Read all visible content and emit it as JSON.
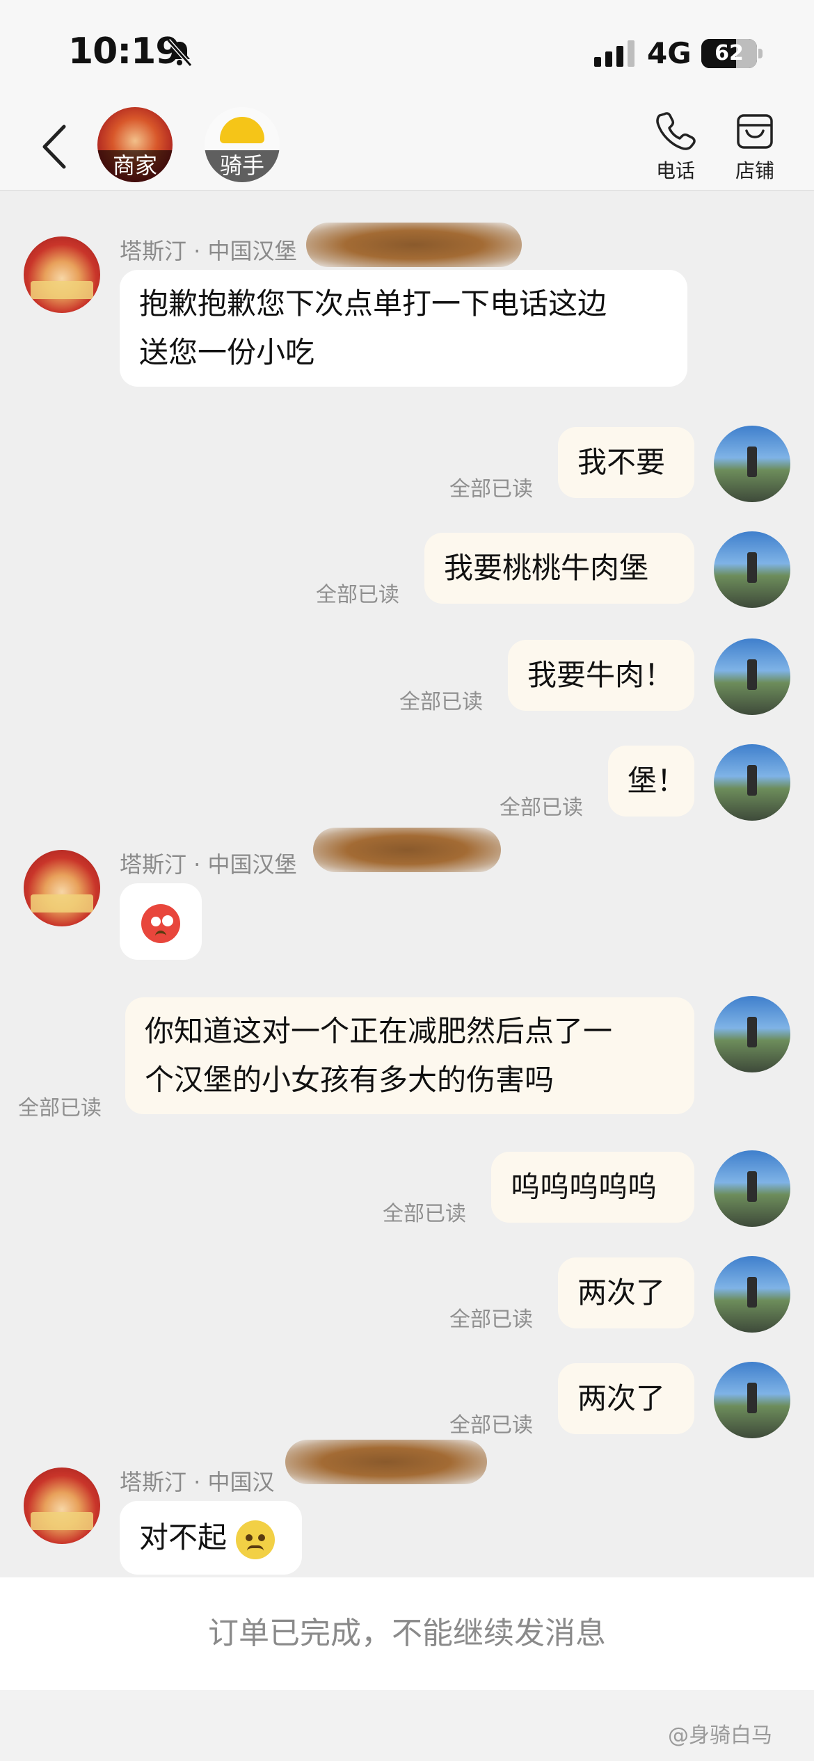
{
  "status_bar": {
    "time": "10:19",
    "network": "4G",
    "battery": "62",
    "battery_level": 0.62,
    "icons": [
      "bell-muted-icon",
      "signal-icon",
      "battery-icon"
    ]
  },
  "header": {
    "tabs": [
      {
        "label": "商家",
        "icon": "shop-avatar"
      },
      {
        "label": "骑手",
        "icon": "rider-helmet-icon"
      }
    ],
    "actions": [
      {
        "label": "电话",
        "icon": "phone-icon"
      },
      {
        "label": "店铺",
        "icon": "store-icon"
      }
    ]
  },
  "messages": [
    {
      "side": "in",
      "sender": "塔斯汀 · 中国汉堡",
      "text_lines": [
        "抱歉抱歉您下次点单打一下电话这边",
        "送您一份小吃"
      ]
    },
    {
      "side": "out",
      "text": "我不要",
      "status": "全部已读"
    },
    {
      "side": "out",
      "text": "我要桃桃牛肉堡",
      "status": "全部已读"
    },
    {
      "side": "out",
      "text": "我要牛肉！",
      "status": "全部已读"
    },
    {
      "side": "out",
      "text": "堡！",
      "status": "全部已读"
    },
    {
      "side": "in",
      "sender": "塔斯汀 · 中国汉堡",
      "emoji": "flushed-face-emoji"
    },
    {
      "side": "out",
      "text_lines": [
        "你知道这对一个正在减肥然后点了一",
        "个汉堡的小女孩有多大的伤害吗"
      ],
      "status": "全部已读"
    },
    {
      "side": "out",
      "text": "呜呜呜呜呜",
      "status": "全部已读"
    },
    {
      "side": "out",
      "text": "两次了",
      "status": "全部已读"
    },
    {
      "side": "out",
      "text": "两次了",
      "status": "全部已读"
    },
    {
      "side": "in",
      "sender": "塔斯汀 · 中国汉",
      "text": "对不起",
      "emoji": "pleading-face-emoji"
    }
  ],
  "footer": {
    "notice": "订单已完成，不能继续发消息"
  },
  "watermark": "@身骑白马",
  "colors": {
    "page_bg": "#efefef",
    "incoming_bubble": "#ffffff",
    "outgoing_bubble": "#fdf8ee",
    "read_status": "#8f8f8f"
  }
}
